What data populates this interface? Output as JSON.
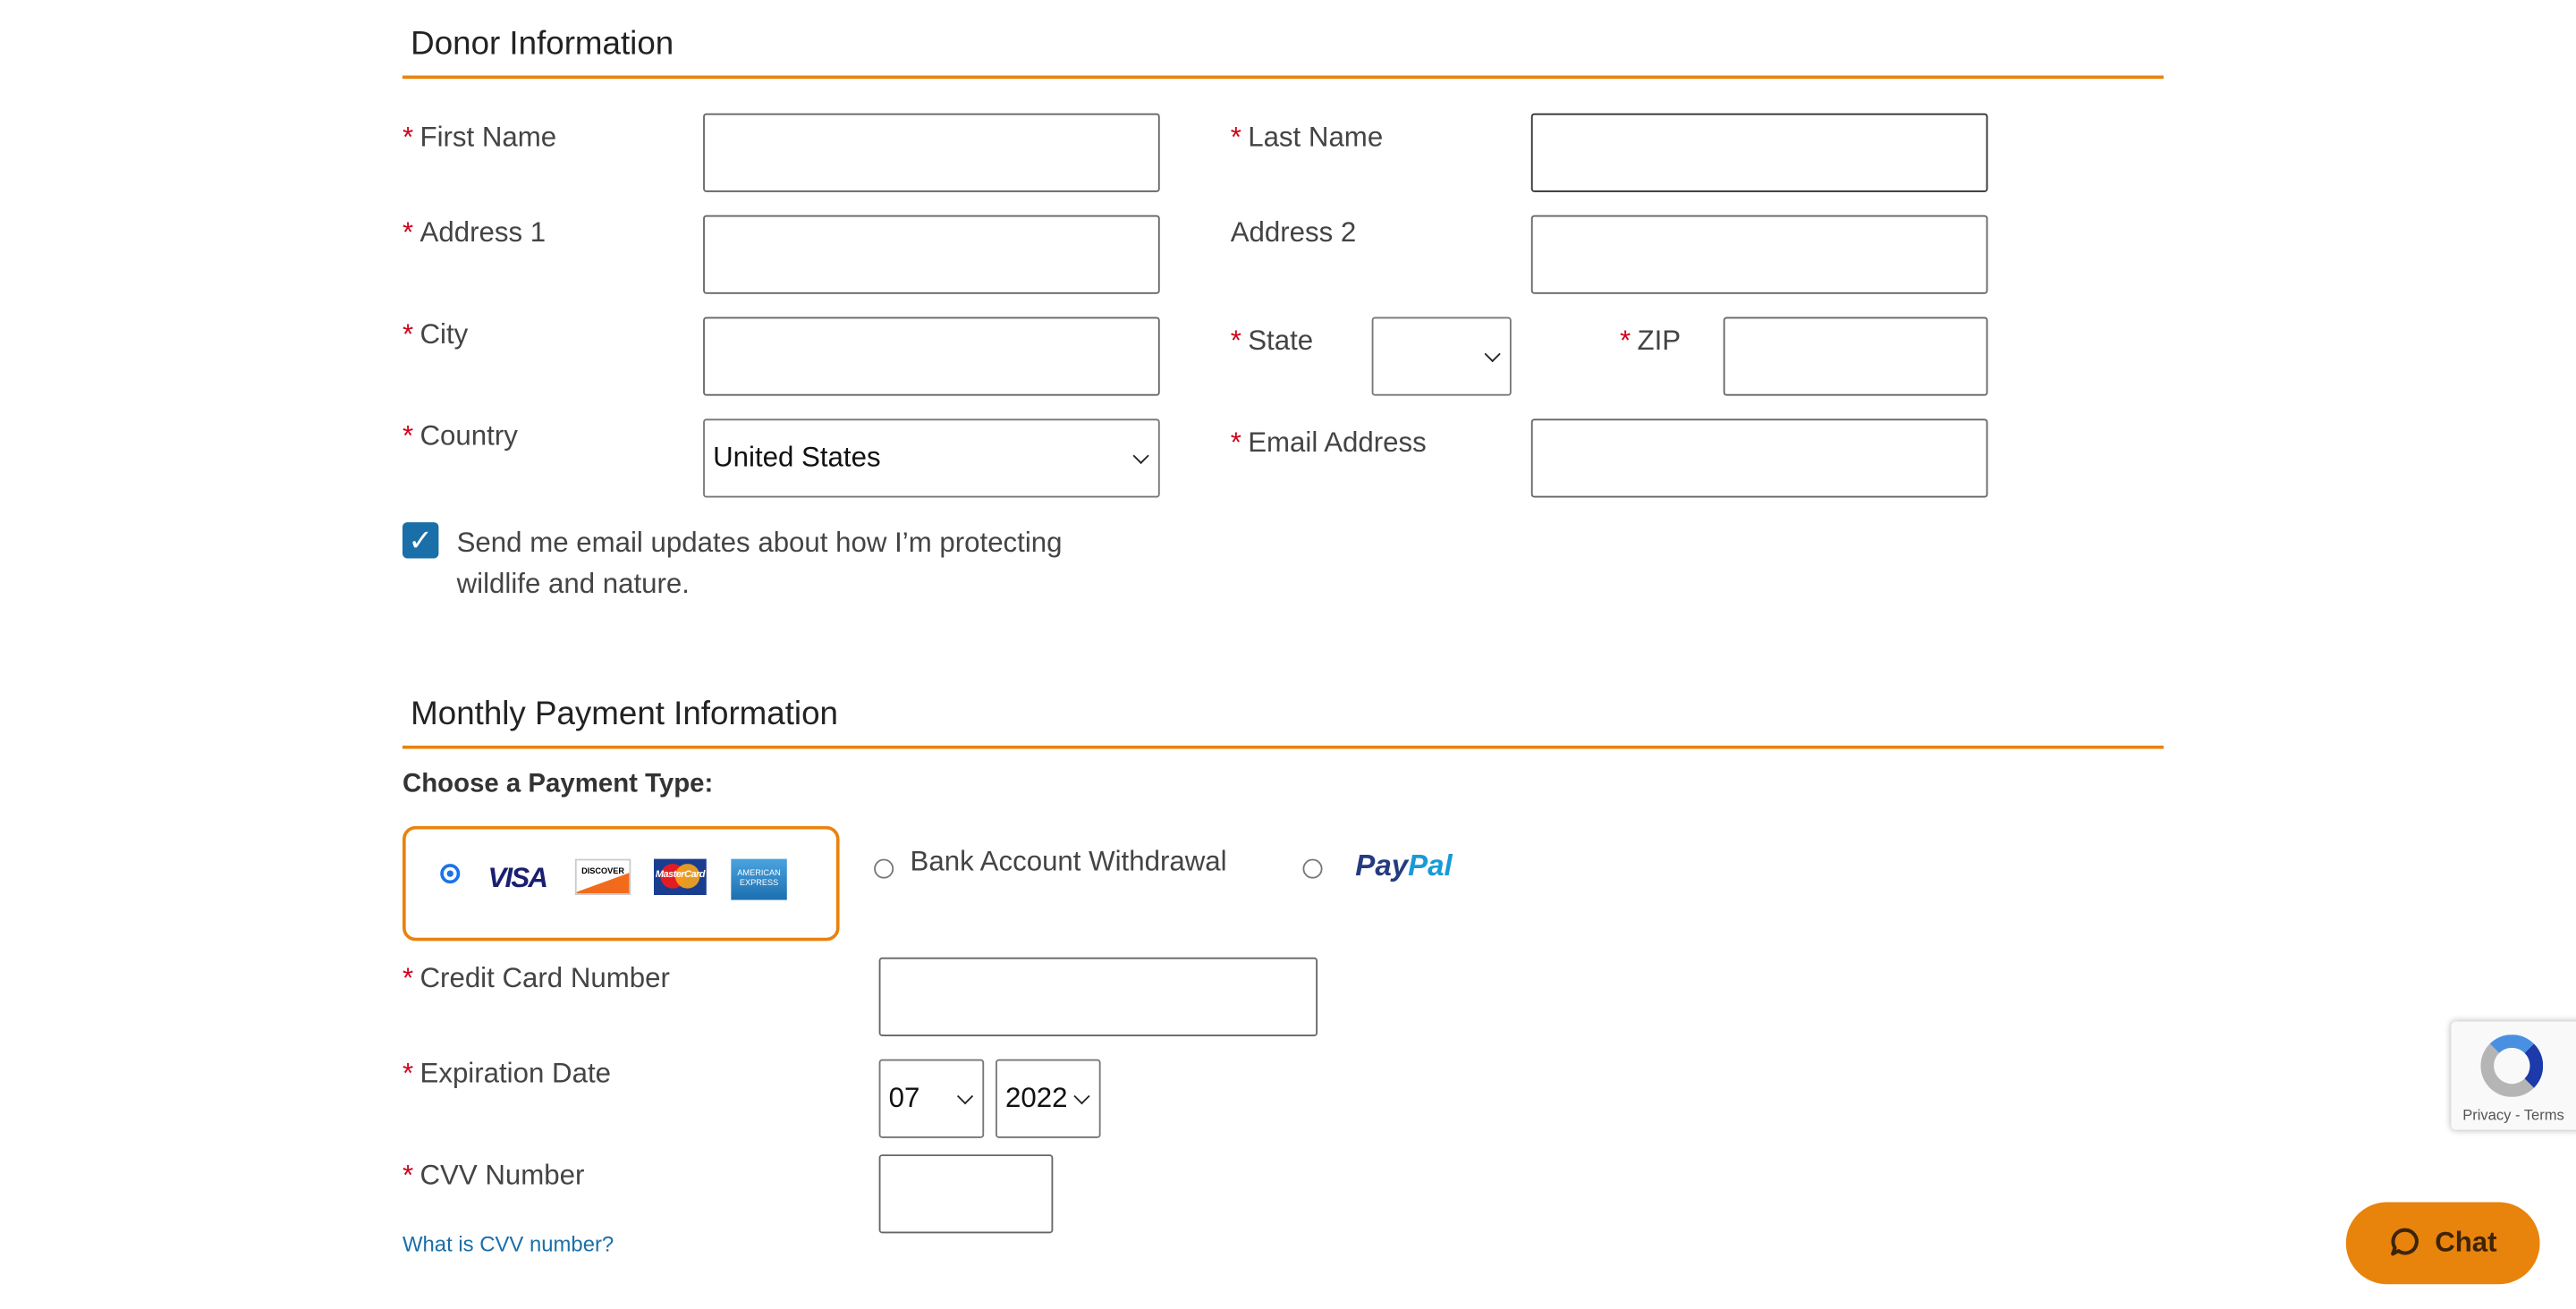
{
  "donor": {
    "title": "Donor Information",
    "first_name": {
      "label": "First Name",
      "value": ""
    },
    "last_name": {
      "label": "Last Name",
      "value": ""
    },
    "address1": {
      "label": "Address 1",
      "value": ""
    },
    "address2": {
      "label": "Address 2",
      "value": ""
    },
    "city": {
      "label": "City",
      "value": ""
    },
    "state": {
      "label": "State",
      "value": ""
    },
    "zip": {
      "label": "ZIP",
      "value": ""
    },
    "country": {
      "label": "Country",
      "value": "United States"
    },
    "email": {
      "label": "Email Address",
      "value": ""
    },
    "updates_checkbox": {
      "checked": true,
      "line1": "Send me email updates about how I’m protecting",
      "line2": "wildlife and nature."
    }
  },
  "payment": {
    "title": "Monthly Payment Information",
    "choose_label": "Choose a Payment Type:",
    "options": [
      {
        "id": "credit-card",
        "selected": true,
        "cards": [
          "VISA",
          "DISCOVER",
          "MasterCard",
          "AMERICAN EXPRESS"
        ]
      },
      {
        "id": "bank",
        "label": "Bank Account Withdrawal",
        "selected": false
      },
      {
        "id": "paypal",
        "logo_text_1": "Pay",
        "logo_text_2": "Pal",
        "selected": false
      }
    ],
    "card_number": {
      "label": "Credit Card Number",
      "value": ""
    },
    "expiration": {
      "label": "Expiration Date",
      "month": "07",
      "year": "2022"
    },
    "cvv": {
      "label": "CVV Number",
      "value": ""
    },
    "cvv_help_link": "What is CVV number?"
  },
  "recaptcha": {
    "links": "Privacy - Terms"
  },
  "chat": {
    "label": "Chat"
  },
  "colors": {
    "accent": "#e8830c",
    "required": "#d0021b",
    "link": "#1a6fa8",
    "checkbox": "#1a6fa8"
  },
  "required_marker": "*"
}
